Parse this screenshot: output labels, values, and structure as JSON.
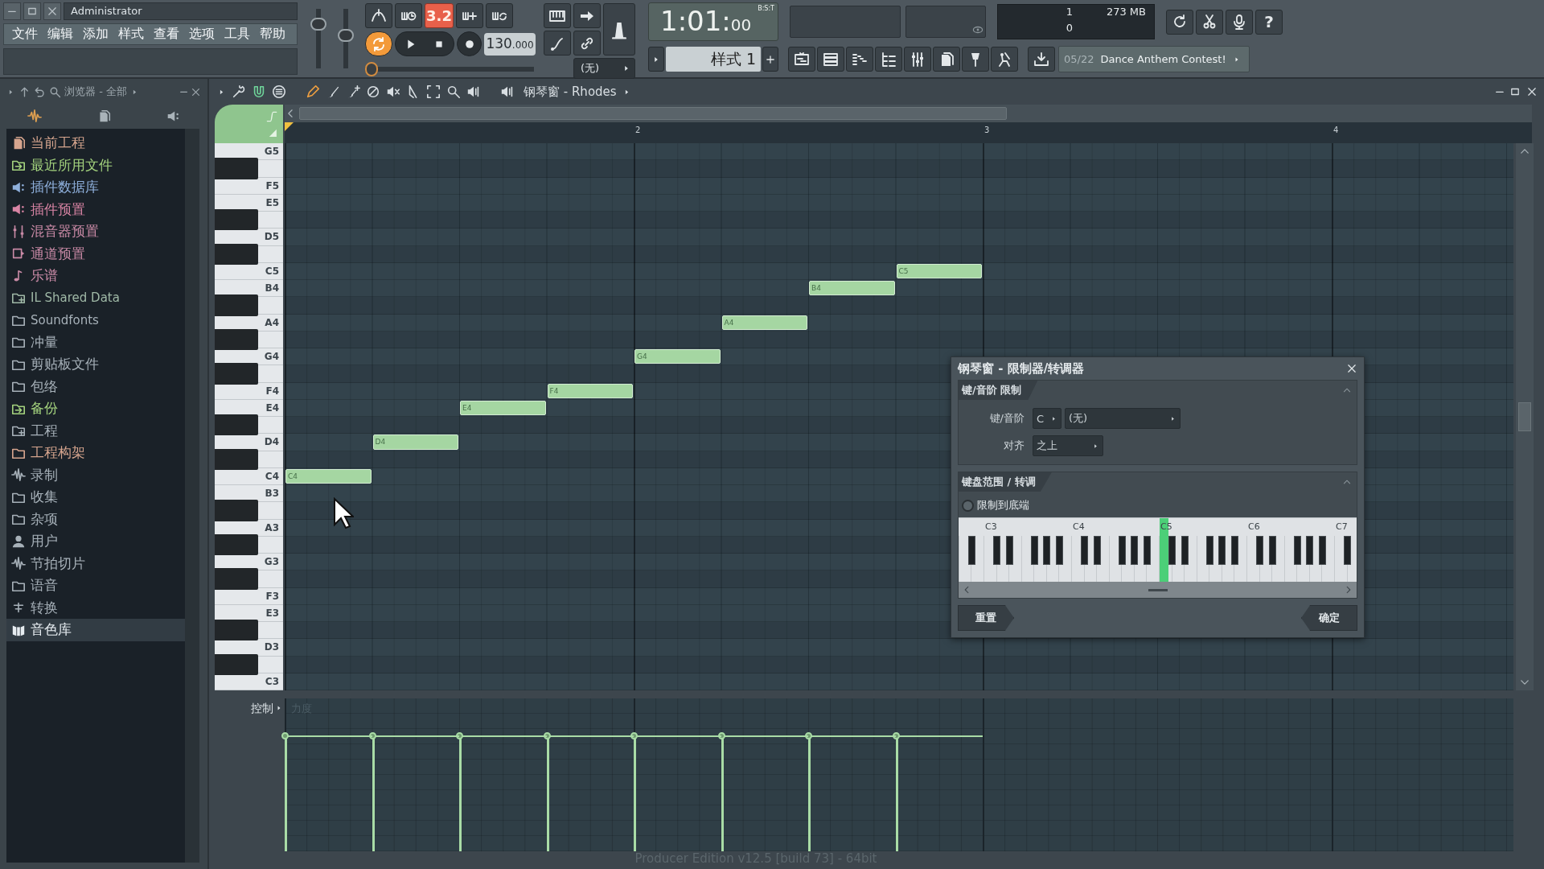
{
  "titlebar": {
    "user": "Administrator"
  },
  "menu": [
    "文件",
    "编辑",
    "添加",
    "样式",
    "查看",
    "选项",
    "工具",
    "帮助"
  ],
  "sliders": [
    {
      "level": 0.8
    },
    {
      "level": 0.55
    }
  ],
  "transport": {
    "snap": "3.2",
    "loop_on": true,
    "tempo": "130",
    "tempo_fraction": ".000",
    "position": {
      "level": 0
    },
    "channel": "(无)",
    "time": "1:01:",
    "time_small": "00",
    "time_unit": "B:S:T",
    "pattern": "样式 1"
  },
  "monitor": {
    "voices": "1",
    "memory": "273 MB",
    "cpu": "0"
  },
  "help": "?",
  "news": {
    "date": "05/22",
    "title": "Dance Anthem Contest!"
  },
  "browser": {
    "title": "浏览器 - 全部",
    "items": [
      {
        "label": "当前工程",
        "kind": "file",
        "color": "#d6a58e",
        "selected": false
      },
      {
        "label": "最近所用文件",
        "kind": "folder-arrow",
        "color": "#a4d37e",
        "selected": false
      },
      {
        "label": "插件数据库",
        "kind": "speaker",
        "color": "#8fb0dc",
        "selected": false
      },
      {
        "label": "插件预置",
        "kind": "speaker",
        "color": "#d884a4",
        "selected": false
      },
      {
        "label": "混音器预置",
        "kind": "sliders",
        "color": "#c98aa6",
        "selected": false
      },
      {
        "label": "通道预置",
        "kind": "channel",
        "color": "#c98aa6",
        "selected": false
      },
      {
        "label": "乐谱",
        "kind": "note",
        "color": "#c98aa6",
        "selected": false
      },
      {
        "label": "IL Shared Data",
        "kind": "folder-plus",
        "color": "#9fb8a6",
        "selected": false
      },
      {
        "label": "Soundfonts",
        "kind": "folder",
        "color": "#a7b1b9",
        "selected": false
      },
      {
        "label": "冲量",
        "kind": "folder",
        "color": "#a7b1b9",
        "selected": false
      },
      {
        "label": "剪贴板文件",
        "kind": "folder",
        "color": "#a7b1b9",
        "selected": false
      },
      {
        "label": "包络",
        "kind": "folder",
        "color": "#a7b1b9",
        "selected": false
      },
      {
        "label": "备份",
        "kind": "folder-arrow",
        "color": "#a4d37e",
        "selected": false
      },
      {
        "label": "工程",
        "kind": "folder-plus",
        "color": "#a7b1b9",
        "selected": false
      },
      {
        "label": "工程构架",
        "kind": "folder",
        "color": "#d6a58e",
        "selected": false
      },
      {
        "label": "录制",
        "kind": "wave",
        "color": "#a7b1b9",
        "selected": false
      },
      {
        "label": "收集",
        "kind": "folder",
        "color": "#a7b1b9",
        "selected": false
      },
      {
        "label": "杂项",
        "kind": "folder",
        "color": "#a7b1b9",
        "selected": false
      },
      {
        "label": "用户",
        "kind": "user",
        "color": "#a7b1b9",
        "selected": false
      },
      {
        "label": "节拍切片",
        "kind": "wave",
        "color": "#a7b1b9",
        "selected": false
      },
      {
        "label": "语音",
        "kind": "folder",
        "color": "#a7b1b9",
        "selected": false
      },
      {
        "label": "转换",
        "kind": "convert",
        "color": "#a7b1b9",
        "selected": false
      },
      {
        "label": "音色库",
        "kind": "library",
        "color": "#e6ecf0",
        "selected": true
      }
    ]
  },
  "piano_roll": {
    "title": "钢琴窗 - Rhodes",
    "ruler": [
      "2",
      "3",
      "4"
    ],
    "keys": [
      {
        "kind": "white",
        "label": "G5"
      },
      {
        "kind": "black"
      },
      {
        "kind": "white",
        "label": "F5"
      },
      {
        "kind": "white",
        "label": "E5"
      },
      {
        "kind": "black"
      },
      {
        "kind": "white",
        "label": "D5"
      },
      {
        "kind": "black"
      },
      {
        "kind": "white",
        "label": "C5",
        "notes": [
          {
            "label": "C5"
          }
        ]
      },
      {
        "kind": "white",
        "label": "B4",
        "notes": [
          {
            "label": "B4"
          }
        ]
      },
      {
        "kind": "black"
      },
      {
        "kind": "white",
        "label": "A4",
        "notes": [
          {
            "label": "A4"
          }
        ]
      },
      {
        "kind": "black"
      },
      {
        "kind": "white",
        "label": "G4",
        "notes": [
          {
            "label": "G4"
          }
        ]
      },
      {
        "kind": "black"
      },
      {
        "kind": "white",
        "label": "F4",
        "notes": [
          {
            "label": "F4"
          }
        ]
      },
      {
        "kind": "white",
        "label": "E4",
        "notes": [
          {
            "label": "E4"
          }
        ]
      },
      {
        "kind": "black"
      },
      {
        "kind": "white",
        "label": "D4",
        "notes": [
          {
            "label": "D4"
          }
        ]
      },
      {
        "kind": "black"
      },
      {
        "kind": "white",
        "label": "C4",
        "notes": [
          {
            "label": "C4"
          }
        ]
      },
      {
        "kind": "white",
        "label": "B3"
      },
      {
        "kind": "black"
      },
      {
        "kind": "white",
        "label": "A3"
      },
      {
        "kind": "black"
      },
      {
        "kind": "white",
        "label": "G3"
      },
      {
        "kind": "black"
      },
      {
        "kind": "white",
        "label": "F3"
      },
      {
        "kind": "white",
        "label": "E3"
      },
      {
        "kind": "black"
      },
      {
        "kind": "white",
        "label": "D3"
      },
      {
        "kind": "black"
      },
      {
        "kind": "white",
        "label": "C3"
      }
    ],
    "control_label": "控制",
    "event_label": "力度"
  },
  "dialog": {
    "title": "钢琴窗 - 限制器/转调器",
    "key_section": {
      "title": "键/音阶 限制",
      "key_label": "键/音阶",
      "key": "C",
      "scale": "(无)",
      "snap_label": "对齐",
      "snap": "之上"
    },
    "range_section": {
      "title": "键盘范围 / 转调",
      "option": {
        "label": "限制到底端",
        "checked": false
      },
      "octaves": [
        {
          "label": "C3",
          "selected": false
        },
        {
          "label": "C4",
          "selected": false
        },
        {
          "label": "C5",
          "selected": true
        },
        {
          "label": "C6",
          "selected": false
        },
        {
          "label": "C7",
          "selected": false
        }
      ]
    },
    "buttons": [
      {
        "label": "重置",
        "kind": "left"
      },
      {
        "label": "确定",
        "kind": "right"
      }
    ]
  },
  "status": "Producer Edition v12.5 [build 73] - 64bit"
}
